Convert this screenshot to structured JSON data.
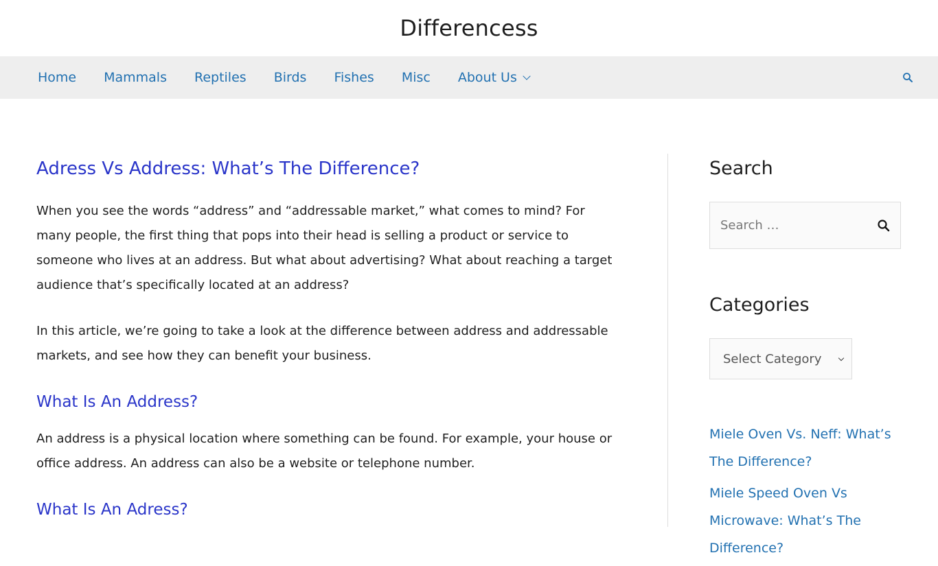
{
  "site": {
    "title": "Differencess"
  },
  "nav": {
    "items": [
      {
        "label": "Home"
      },
      {
        "label": "Mammals"
      },
      {
        "label": "Reptiles"
      },
      {
        "label": "Birds"
      },
      {
        "label": "Fishes"
      },
      {
        "label": "Misc"
      },
      {
        "label": "About Us",
        "has_dropdown": true
      }
    ],
    "search_icon": "search-icon"
  },
  "article": {
    "title": "Adress Vs Address: What’s The Difference?",
    "paragraphs": [
      "When you see the words “address” and “addressable market,” what comes to mind? For many people, the first thing that pops into their head is selling a product or service to someone who lives at an address. But what about advertising? What about reaching a target audience that’s specifically located at an address?",
      "In this article, we’re going to take a look at the difference between address and addressable markets, and see how they can benefit your business."
    ],
    "sections": [
      {
        "heading": "What Is An Address?",
        "text": "An address is a physical location where something can be found. For example, your house or office address. An address can also be a website or telephone number."
      },
      {
        "heading": "What Is An Adress?"
      }
    ]
  },
  "sidebar": {
    "search": {
      "title": "Search",
      "placeholder": "Search …"
    },
    "categories": {
      "title": "Categories",
      "selected": "Select Category"
    },
    "recent_posts": [
      {
        "label": "Miele Oven Vs. Neff: What’s The Difference?"
      },
      {
        "label": "Miele Speed Oven Vs Microwave: What’s The Difference?"
      }
    ]
  },
  "colors": {
    "link": "#2271b1",
    "heading_link": "#2a35c9",
    "nav_bg": "#eeeeee"
  }
}
